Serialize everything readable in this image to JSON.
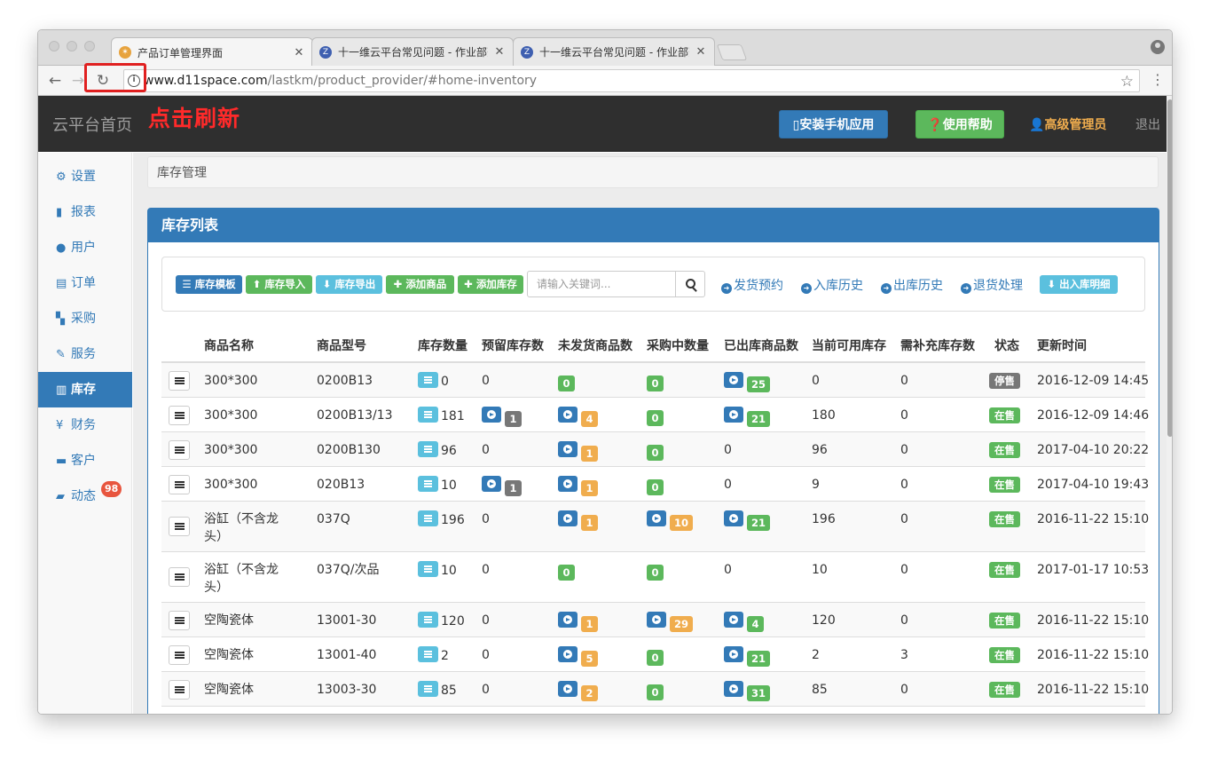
{
  "browser": {
    "tabs": [
      {
        "title": "产品订单管理界面"
      },
      {
        "title": "十一维云平台常见问题 - 作业部落"
      },
      {
        "title": "十一维云平台常见问题 - 作业部落"
      }
    ],
    "url_host": "www.d11space.com",
    "url_path": "/lastkm/product_provider/#home-inventory"
  },
  "annotation": "点击刷新",
  "header": {
    "brand": "云平台首页",
    "install_app": "安装手机应用",
    "help": "使用帮助",
    "admin": "高级管理员",
    "logout": "退出"
  },
  "sidebar": {
    "items": [
      {
        "label": "设置",
        "icon": "gear-icon"
      },
      {
        "label": "报表",
        "icon": "bar-chart-icon"
      },
      {
        "label": "用户",
        "icon": "user-icon"
      },
      {
        "label": "订单",
        "icon": "list-alt-icon"
      },
      {
        "label": "采购",
        "icon": "cart-icon"
      },
      {
        "label": "服务",
        "icon": "wrench-icon"
      },
      {
        "label": "库存",
        "icon": "barcode-icon"
      },
      {
        "label": "财务",
        "icon": "yen-icon"
      },
      {
        "label": "客户",
        "icon": "briefcase-icon"
      },
      {
        "label": "动态",
        "icon": "comment-icon"
      }
    ],
    "active": "库存",
    "badge": "98"
  },
  "breadcrumb": "库存管理",
  "panel": {
    "title": "库存列表",
    "buttons": [
      "库存模板",
      "库存导入",
      "库存导出",
      "添加商品",
      "添加库存"
    ],
    "search_placeholder": "请输入关键词...",
    "links": [
      "发货预约",
      "入库历史",
      "出库历史",
      "退货处理"
    ],
    "detail_button": "出入库明细"
  },
  "table": {
    "columns": [
      "商品名称",
      "商品型号",
      "库存数量",
      "预留库存数",
      "未发货商品数",
      "采购中数量",
      "已出库商品数",
      "当前可用库存",
      "需补充库存数",
      "状态",
      "更新时间"
    ],
    "rows": [
      {
        "name": "300*300",
        "model": "0200B13",
        "stock": "0",
        "reserved": "0",
        "unshipped": "0",
        "purchasing": "0",
        "outbound": "25",
        "available": "0",
        "replenish": "0",
        "status": "停售",
        "updated": "2016-12-09 14:45"
      },
      {
        "name": "300*300",
        "model": "0200B13/13",
        "stock": "181",
        "reserved": "1",
        "unshipped": "4",
        "purchasing": "0",
        "outbound": "21",
        "available": "180",
        "replenish": "0",
        "status": "在售",
        "updated": "2016-12-09 14:46"
      },
      {
        "name": "300*300",
        "model": "0200B130",
        "stock": "96",
        "reserved": "0",
        "unshipped": "1",
        "purchasing": "0",
        "outbound": "0",
        "available": "96",
        "replenish": "0",
        "status": "在售",
        "updated": "2017-04-10 20:22"
      },
      {
        "name": "300*300",
        "model": "020B13",
        "stock": "10",
        "reserved": "1",
        "unshipped": "1",
        "purchasing": "0",
        "outbound": "0",
        "available": "9",
        "replenish": "0",
        "status": "在售",
        "updated": "2017-04-10 19:43"
      },
      {
        "name": "浴缸（不含龙头）",
        "model": "037Q",
        "stock": "196",
        "reserved": "0",
        "unshipped": "1",
        "purchasing": "10",
        "outbound": "21",
        "available": "196",
        "replenish": "0",
        "status": "在售",
        "updated": "2016-11-22 15:10"
      },
      {
        "name": "浴缸（不含龙头）",
        "model": "037Q/次品",
        "stock": "10",
        "reserved": "0",
        "unshipped": "0",
        "purchasing": "0",
        "outbound": "0",
        "available": "10",
        "replenish": "0",
        "status": "在售",
        "updated": "2017-01-17 10:53"
      },
      {
        "name": "空陶瓷体",
        "model": "13001-30",
        "stock": "120",
        "reserved": "0",
        "unshipped": "1",
        "purchasing": "29",
        "outbound": "4",
        "available": "120",
        "replenish": "0",
        "status": "在售",
        "updated": "2016-11-22 15:10"
      },
      {
        "name": "空陶瓷体",
        "model": "13001-40",
        "stock": "2",
        "reserved": "0",
        "unshipped": "5",
        "purchasing": "0",
        "outbound": "21",
        "available": "2",
        "replenish": "3",
        "status": "在售",
        "updated": "2016-11-22 15:10"
      },
      {
        "name": "空陶瓷体",
        "model": "13003-30",
        "stock": "85",
        "reserved": "0",
        "unshipped": "2",
        "purchasing": "0",
        "outbound": "31",
        "available": "85",
        "replenish": "0",
        "status": "在售",
        "updated": "2016-11-22 15:10"
      }
    ]
  },
  "colors": {
    "primary": "#337ab7",
    "success": "#5cb85c",
    "info": "#5bc0de",
    "warning": "#f0ad4e",
    "muted": "#777777",
    "header_bg": "#2f2f2f",
    "annotation_red": "#ff2a2a"
  }
}
